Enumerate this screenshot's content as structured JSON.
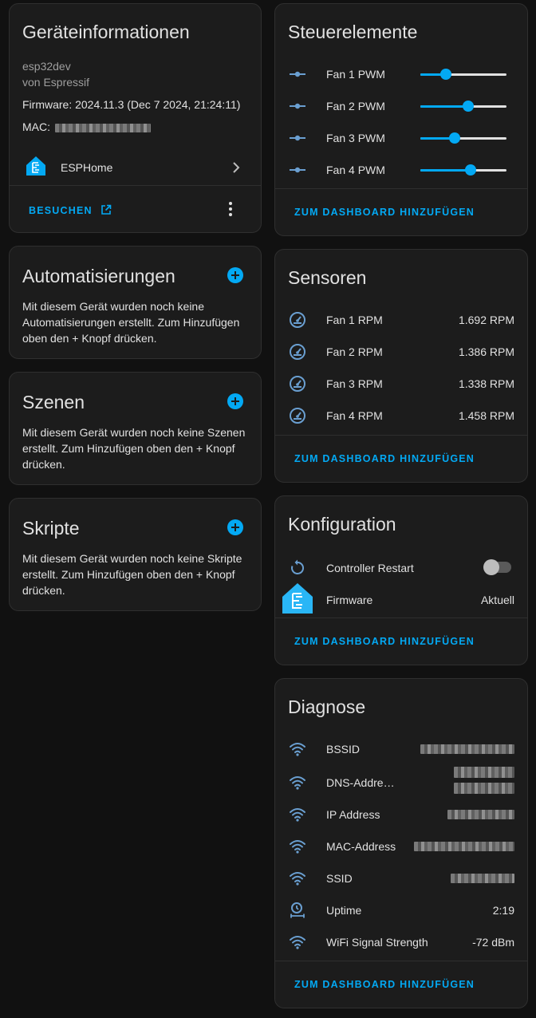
{
  "device_info": {
    "title": "Geräteinformationen",
    "model": "esp32dev",
    "manufacturer": "von Espressif",
    "firmware": "Firmware: 2024.11.3 (Dec 7 2024, 21:24:11)",
    "mac_label": "MAC:",
    "integration": "ESPHome",
    "visit_label": "BESUCHEN"
  },
  "automations": {
    "title": "Automatisierungen",
    "text": "Mit diesem Gerät wurden noch keine Automatisierungen erstellt. Zum Hinzufügen oben den + Knopf drücken."
  },
  "scenes": {
    "title": "Szenen",
    "text": "Mit diesem Gerät wurden noch keine Szenen erstellt. Zum Hinzufügen oben den + Knopf drücken."
  },
  "scripts": {
    "title": "Skripte",
    "text": "Mit diesem Gerät wurden noch keine Skripte erstellt. Zum Hinzufügen oben den + Knopf drücken."
  },
  "controls": {
    "title": "Steuerelemente",
    "items": [
      {
        "label": "Fan 1 PWM",
        "level": 0.3
      },
      {
        "label": "Fan 2 PWM",
        "level": 0.56
      },
      {
        "label": "Fan 3 PWM",
        "level": 0.4
      },
      {
        "label": "Fan 4 PWM",
        "level": 0.58
      }
    ],
    "footer": "ZUM DASHBOARD HINZUFÜGEN"
  },
  "sensors": {
    "title": "Sensoren",
    "items": [
      {
        "label": "Fan 1 RPM",
        "value": "1.692 RPM"
      },
      {
        "label": "Fan 2 RPM",
        "value": "1.386 RPM"
      },
      {
        "label": "Fan 3 RPM",
        "value": "1.338 RPM"
      },
      {
        "label": "Fan 4 RPM",
        "value": "1.458 RPM"
      }
    ],
    "footer": "ZUM DASHBOARD HINZUFÜGEN"
  },
  "config": {
    "title": "Konfiguration",
    "restart_label": "Controller Restart",
    "firmware_label": "Firmware",
    "firmware_value": "Aktuell",
    "footer": "ZUM DASHBOARD HINZUFÜGEN"
  },
  "diagnostics": {
    "title": "Diagnose",
    "bssid_label": "BSSID",
    "dns_label": "DNS-Addre…",
    "ip_label": "IP Address",
    "mac_label": "MAC-Address",
    "ssid_label": "SSID",
    "uptime_label": "Uptime",
    "uptime_value": "2:19",
    "wifi_label": "WiFi Signal Strength",
    "wifi_value": "-72 dBm",
    "footer": "ZUM DASHBOARD HINZUFÜGEN"
  },
  "colors": {
    "accent": "#03a9f4",
    "icon": "#6a9fd1",
    "card": "#1c1c1c",
    "background": "#111111"
  }
}
